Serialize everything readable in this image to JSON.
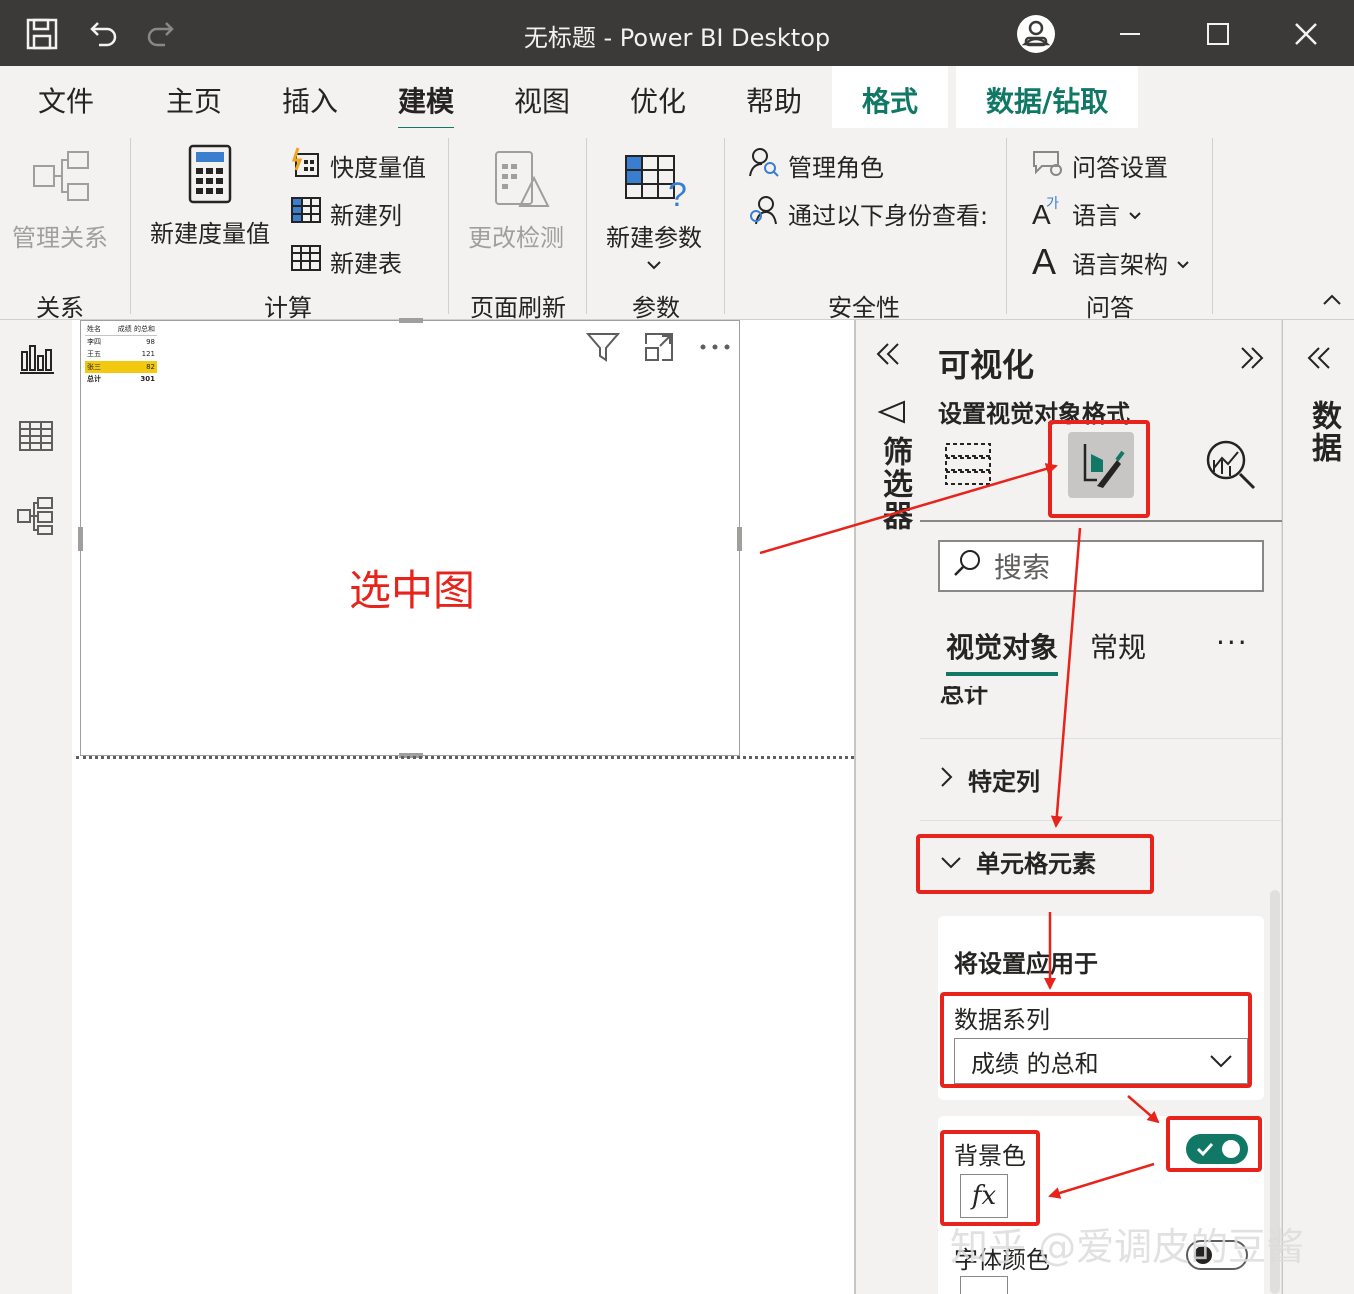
{
  "titlebar": {
    "title": "无标题 - Power BI Desktop",
    "icons": [
      "save-icon",
      "undo-icon",
      "redo-icon",
      "account-icon",
      "minimize-icon",
      "maximize-icon",
      "close-icon"
    ]
  },
  "tabs": [
    {
      "label": "文件"
    },
    {
      "label": "主页"
    },
    {
      "label": "插入"
    },
    {
      "label": "建模",
      "active": true
    },
    {
      "label": "视图"
    },
    {
      "label": "优化"
    },
    {
      "label": "帮助"
    },
    {
      "label": "格式",
      "context": true
    },
    {
      "label": "数据/钻取",
      "context": true
    }
  ],
  "ribbon": {
    "relationships": {
      "manage": "管理关系",
      "group": "关系"
    },
    "calculations": {
      "new_measure": "新建度量值",
      "quick_measure": "快度量值",
      "new_column": "新建列",
      "new_table": "新建表",
      "group": "计算"
    },
    "page_refresh": {
      "change_detection": "更改检测",
      "group": "页面刷新"
    },
    "parameters": {
      "new_parameter": "新建参数",
      "group": "参数"
    },
    "security": {
      "manage_roles": "管理角色",
      "view_as": "通过以下身份查看:",
      "group": "安全性"
    },
    "qa": {
      "qa_setup": "问答设置",
      "language": "语言",
      "linguistic_schema": "语言架构",
      "group": "问答"
    }
  },
  "canvas": {
    "mini_table": {
      "headers": [
        "姓名",
        "成绩 的总和"
      ],
      "rows": [
        [
          "李四",
          "98"
        ],
        [
          "王五",
          "121"
        ],
        [
          "张三",
          "82"
        ]
      ],
      "total": [
        "总计",
        "301"
      ]
    },
    "annotation": "选中图"
  },
  "filters_pane": {
    "label": "筛选器"
  },
  "viz_pane": {
    "title": "可视化",
    "subtitle": "设置视觉对象格式",
    "search_placeholder": "搜索",
    "subtabs": [
      "视觉对象",
      "常规"
    ],
    "more": "···",
    "sections": {
      "total_partial": "总计",
      "specific_column": "特定列",
      "cell_elements": "单元格元素"
    },
    "apply_to": {
      "title": "将设置应用于",
      "series_label": "数据系列",
      "series_value": "成绩 的总和"
    },
    "background_color": {
      "label": "背景色",
      "fx": "fx",
      "toggle_on": true
    },
    "font_color": {
      "label": "字体颜色",
      "toggle_on": false
    }
  },
  "data_pane": {
    "label": "数据"
  },
  "watermark": "知乎 @爱调皮的豆酱",
  "colors": {
    "accent": "#117865",
    "annotation_red": "#e8231b",
    "highlight": "#f2c811",
    "titlebar": "#3b3a39"
  }
}
